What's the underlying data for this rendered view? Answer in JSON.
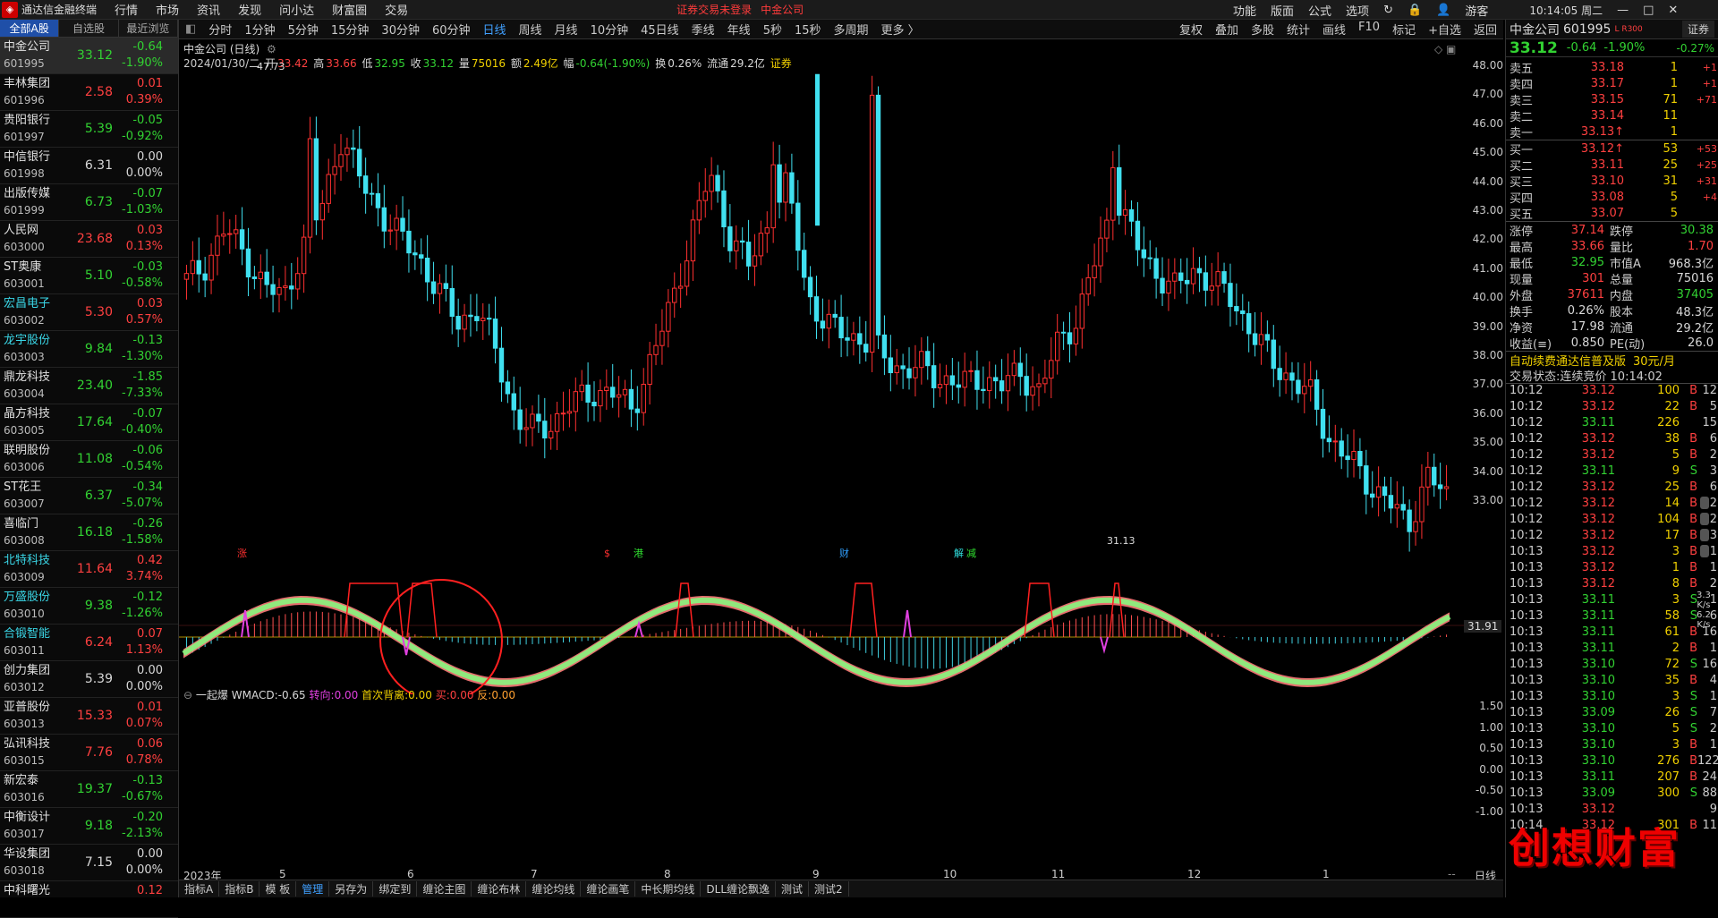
{
  "topbar": {
    "app_title": "通达信金融终端",
    "menus": [
      "行情",
      "市场",
      "资讯",
      "发现",
      "问小达",
      "财富圈",
      "交易"
    ],
    "warning": "证券交易未登录",
    "current_stock": "中金公司",
    "right_menus": [
      "功能",
      "版面",
      "公式",
      "选项"
    ],
    "guest": "游客",
    "time": "10:14:05 周二"
  },
  "stocklist": {
    "tabs": [
      "全部A股",
      "自选股",
      "最近浏览"
    ],
    "rows": [
      {
        "name": "中金公司",
        "code": "601995",
        "price": "33.12",
        "chg": "-0.64",
        "pct": "-1.90%",
        "color": "grn",
        "sel": true
      },
      {
        "name": "丰林集团",
        "code": "601996",
        "price": "2.58",
        "chg": "0.01",
        "pct": "0.39%",
        "color": "red"
      },
      {
        "name": "贵阳银行",
        "code": "601997",
        "price": "5.39",
        "chg": "-0.05",
        "pct": "-0.92%",
        "color": "grn"
      },
      {
        "name": "中信银行",
        "code": "601998",
        "price": "6.31",
        "chg": "0.00",
        "pct": "0.00%",
        "color": "wht"
      },
      {
        "name": "出版传媒",
        "code": "601999",
        "price": "6.73",
        "chg": "-0.07",
        "pct": "-1.03%",
        "color": "grn"
      },
      {
        "name": "人民网",
        "code": "603000",
        "price": "23.68",
        "chg": "0.03",
        "pct": "0.13%",
        "color": "red"
      },
      {
        "name": "ST奥康",
        "code": "603001",
        "price": "5.10",
        "chg": "-0.03",
        "pct": "-0.58%",
        "color": "grn"
      },
      {
        "name": "宏昌电子",
        "code": "603002",
        "price": "5.30",
        "chg": "0.03",
        "pct": "0.57%",
        "color": "red",
        "cy": true
      },
      {
        "name": "龙宇股份",
        "code": "603003",
        "price": "9.84",
        "chg": "-0.13",
        "pct": "-1.30%",
        "color": "grn",
        "cy": true
      },
      {
        "name": "鼎龙科技",
        "code": "603004",
        "price": "23.40",
        "chg": "-1.85",
        "pct": "-7.33%",
        "color": "grn"
      },
      {
        "name": "晶方科技",
        "code": "603005",
        "price": "17.64",
        "chg": "-0.07",
        "pct": "-0.40%",
        "color": "grn"
      },
      {
        "name": "联明股份",
        "code": "603006",
        "price": "11.08",
        "chg": "-0.06",
        "pct": "-0.54%",
        "color": "grn"
      },
      {
        "name": "ST花王",
        "code": "603007",
        "price": "6.37",
        "chg": "-0.34",
        "pct": "-5.07%",
        "color": "grn"
      },
      {
        "name": "喜临门",
        "code": "603008",
        "price": "16.18",
        "chg": "-0.26",
        "pct": "-1.58%",
        "color": "grn"
      },
      {
        "name": "北特科技",
        "code": "603009",
        "price": "11.64",
        "chg": "0.42",
        "pct": "3.74%",
        "color": "red",
        "cy": true
      },
      {
        "name": "万盛股份",
        "code": "603010",
        "price": "9.38",
        "chg": "-0.12",
        "pct": "-1.26%",
        "color": "grn",
        "cy": true
      },
      {
        "name": "合锻智能",
        "code": "603011",
        "price": "6.24",
        "chg": "0.07",
        "pct": "1.13%",
        "color": "red",
        "cy": true
      },
      {
        "name": "创力集团",
        "code": "603012",
        "price": "5.39",
        "chg": "0.00",
        "pct": "0.00%",
        "color": "wht"
      },
      {
        "name": "亚普股份",
        "code": "603013",
        "price": "15.33",
        "chg": "0.01",
        "pct": "0.07%",
        "color": "red"
      },
      {
        "name": "弘讯科技",
        "code": "603015",
        "price": "7.76",
        "chg": "0.06",
        "pct": "0.78%",
        "color": "red"
      },
      {
        "name": "新宏泰",
        "code": "603016",
        "price": "19.37",
        "chg": "-0.13",
        "pct": "-0.67%",
        "color": "grn"
      },
      {
        "name": "中衡设计",
        "code": "603017",
        "price": "9.18",
        "chg": "-0.20",
        "pct": "-2.13%",
        "color": "grn"
      },
      {
        "name": "华设集团",
        "code": "603018",
        "price": "7.15",
        "chg": "0.00",
        "pct": "0.00%",
        "color": "wht"
      },
      {
        "name": "中科曙光",
        "code": "",
        "price": "",
        "chg": "0.12",
        "pct": "",
        "color": "red"
      }
    ]
  },
  "periodbar": {
    "items": [
      "分时",
      "1分钟",
      "5分钟",
      "15分钟",
      "30分钟",
      "60分钟",
      "日线",
      "周线",
      "月线",
      "10分钟",
      "45日线",
      "季线",
      "年线",
      "5秒",
      "15秒",
      "多周期",
      "更多 〉"
    ],
    "active": "日线",
    "right": [
      "复权",
      "叠加",
      "多股",
      "统计",
      "画线",
      "F10",
      "标记",
      "+自选",
      "返回"
    ]
  },
  "chart": {
    "title": "中金公司 (日线)",
    "date": "2024/01/30/二",
    "open_label": "开",
    "open": "33.42",
    "high_label": "高",
    "high": "33.66",
    "low_label": "低",
    "low": "32.95",
    "close_label": "收",
    "close": "33.12",
    "vol_label": "量",
    "vol": "75016",
    "amt_label": "额",
    "amt": "2.49亿",
    "range_label": "幅",
    "range": "-0.64(-1.90%)",
    "turn_label": "换",
    "turn": "0.26%",
    "float_label": "流通",
    "float": "29.2亿",
    "tag": "证券",
    "max_label": "47.73",
    "min_label": "31.13",
    "cur_price": "31.91",
    "price_ticks": [
      "48.00",
      "47.00",
      "46.00",
      "45.00",
      "44.00",
      "43.00",
      "42.00",
      "41.00",
      "40.00",
      "39.00",
      "38.00",
      "37.00",
      "36.00",
      "35.00",
      "34.00",
      "33.00"
    ],
    "event_marks": [
      "涨",
      "$",
      "港",
      "财",
      "解",
      "减"
    ],
    "indicator": {
      "name": "一起爆",
      "wmacd_label": "WMACD:",
      "wmacd": "-0.65",
      "zx_label": "转向:",
      "zx": "0.00",
      "sc_label": "首次背离:",
      "sc": "0.00",
      "buy_label": "买:",
      "buy": "0.00",
      "fan_label": "反:",
      "fan": "0.00",
      "ticks": [
        "1.50",
        "1.00",
        "0.50",
        "0.00",
        "-0.50",
        "-1.00"
      ]
    },
    "x_labels": [
      "2023年",
      "5",
      "6",
      "7",
      "8",
      "9",
      "10",
      "11",
      "12",
      "1"
    ],
    "x_right": "日线"
  },
  "chart_data": {
    "type": "candlestick",
    "title": "中金公司 (日线)",
    "ylim": [
      31.0,
      48.5
    ],
    "x": [
      "2023年",
      "5",
      "6",
      "7",
      "8",
      "9",
      "10",
      "11",
      "12",
      "1"
    ],
    "close": [
      40.6,
      41.2,
      42.4,
      41.5,
      40.4,
      40.0,
      41.8,
      43.2,
      45.6,
      44.0,
      43.0,
      42.1,
      41.4,
      40.2,
      39.2,
      39.6,
      38.1,
      35.8,
      35.4,
      35.8,
      36.4,
      36.8,
      36.7,
      36.2,
      37.9,
      39.8,
      42.1,
      44.3,
      42.2,
      41.1,
      42.6,
      43.9,
      40.2,
      39.0,
      38.8,
      38.5,
      38.0,
      37.5,
      37.6,
      37.2,
      37.0,
      37.3,
      36.9,
      37.5,
      36.7,
      38.6,
      39.3,
      41.6,
      43.5,
      41.8,
      40.9,
      40.3,
      41.0,
      40.5,
      39.9,
      38.8,
      37.8,
      37.2,
      36.6,
      35.1,
      34.4,
      33.6,
      33.0,
      32.1,
      33.9,
      33.12
    ]
  },
  "quote": {
    "name": "中金公司",
    "code": "601995",
    "badge": "L R300",
    "tab": "证券",
    "price": "33.12",
    "chg": "-0.64",
    "pct": "-1.90%",
    "pct2": "-0.27%",
    "asks": [
      {
        "l": "卖五",
        "p": "33.18",
        "v": "1",
        "d": "+1"
      },
      {
        "l": "卖四",
        "p": "33.17",
        "v": "1",
        "d": "+1"
      },
      {
        "l": "卖三",
        "p": "33.15",
        "v": "71",
        "d": "+71"
      },
      {
        "l": "卖二",
        "p": "33.14",
        "v": "11",
        "d": ""
      },
      {
        "l": "卖一",
        "p": "33.13↑",
        "v": "1",
        "d": ""
      }
    ],
    "bids": [
      {
        "l": "买一",
        "p": "33.12↑",
        "v": "53",
        "d": "+53"
      },
      {
        "l": "买二",
        "p": "33.11",
        "v": "25",
        "d": "+25"
      },
      {
        "l": "买三",
        "p": "33.10",
        "v": "31",
        "d": "+31"
      },
      {
        "l": "买四",
        "p": "33.08",
        "v": "5",
        "d": "+4"
      },
      {
        "l": "买五",
        "p": "33.07",
        "v": "5",
        "d": ""
      }
    ],
    "stats": [
      {
        "a": "涨停",
        "b": "37.14",
        "bc": "red",
        "c": "跌停",
        "d": "30.38",
        "dc": "grn"
      },
      {
        "a": "最高",
        "b": "33.66",
        "bc": "red",
        "c": "量比",
        "d": "1.70",
        "dc": "red"
      },
      {
        "a": "最低",
        "b": "32.95",
        "bc": "grn",
        "c": "市值A",
        "d": "968.3亿",
        "dc": "wht"
      },
      {
        "a": "现量",
        "b": "301",
        "bc": "red",
        "c": "总量",
        "d": "75016",
        "dc": "wht"
      },
      {
        "a": "外盘",
        "b": "37611",
        "bc": "red",
        "c": "内盘",
        "d": "37405",
        "dc": "grn"
      },
      {
        "a": "换手",
        "b": "0.26%",
        "bc": "wht",
        "c": "股本",
        "d": "48.3亿",
        "dc": "wht"
      },
      {
        "a": "净资",
        "b": "17.98",
        "bc": "wht",
        "c": "流通",
        "d": "29.2亿",
        "dc": "wht"
      },
      {
        "a": "收益(≡)",
        "b": "0.850",
        "bc": "wht",
        "c": "PE(动)",
        "d": "26.0",
        "dc": "wht"
      }
    ],
    "ad": "自动续费通达信普及版",
    "ad_price": "30元/月",
    "status_label": "交易状态:",
    "status": "连续竞价 10:14:02",
    "ticks": [
      {
        "t": "10:12",
        "p": "33.12",
        "v": "100",
        "d": "B",
        "n": "12"
      },
      {
        "t": "10:12",
        "p": "33.12",
        "v": "22",
        "d": "B",
        "n": "5"
      },
      {
        "t": "10:12",
        "p": "33.11",
        "v": "226",
        "d": "",
        "n": "15"
      },
      {
        "t": "10:12",
        "p": "33.12",
        "v": "38",
        "d": "B",
        "n": "6"
      },
      {
        "t": "10:12",
        "p": "33.12",
        "v": "5",
        "d": "B",
        "n": "2"
      },
      {
        "t": "10:12",
        "p": "33.11",
        "v": "9",
        "d": "S",
        "n": "3"
      },
      {
        "t": "10:12",
        "p": "33.12",
        "v": "25",
        "d": "B",
        "n": "6"
      },
      {
        "t": "10:12",
        "p": "33.12",
        "v": "14",
        "d": "B",
        "n": "2"
      },
      {
        "t": "10:12",
        "p": "33.12",
        "v": "104",
        "d": "B",
        "n": "2"
      },
      {
        "t": "10:12",
        "p": "33.12",
        "v": "17",
        "d": "B",
        "n": "3"
      },
      {
        "t": "10:13",
        "p": "33.12",
        "v": "3",
        "d": "B",
        "n": "1"
      },
      {
        "t": "10:13",
        "p": "33.12",
        "v": "1",
        "d": "B",
        "n": "1"
      },
      {
        "t": "10:13",
        "p": "33.12",
        "v": "8",
        "d": "B",
        "n": "2"
      },
      {
        "t": "10:13",
        "p": "33.11",
        "v": "3",
        "d": "S",
        "n": "1"
      },
      {
        "t": "10:13",
        "p": "33.11",
        "v": "58",
        "d": "S",
        "n": "6"
      },
      {
        "t": "10:13",
        "p": "33.11",
        "v": "61",
        "d": "B",
        "n": "16"
      },
      {
        "t": "10:13",
        "p": "33.11",
        "v": "2",
        "d": "B",
        "n": "1"
      },
      {
        "t": "10:13",
        "p": "33.10",
        "v": "72",
        "d": "S",
        "n": "16"
      },
      {
        "t": "10:13",
        "p": "33.10",
        "v": "35",
        "d": "B",
        "n": "4"
      },
      {
        "t": "10:13",
        "p": "33.10",
        "v": "3",
        "d": "S",
        "n": "1"
      },
      {
        "t": "10:13",
        "p": "33.09",
        "v": "26",
        "d": "S",
        "n": "7"
      },
      {
        "t": "10:13",
        "p": "33.10",
        "v": "5",
        "d": "S",
        "n": "2"
      },
      {
        "t": "10:13",
        "p": "33.10",
        "v": "3",
        "d": "B",
        "n": "1"
      },
      {
        "t": "10:13",
        "p": "33.10",
        "v": "276",
        "d": "B",
        "n": "122"
      },
      {
        "t": "10:13",
        "p": "33.11",
        "v": "207",
        "d": "B",
        "n": "24"
      },
      {
        "t": "10:13",
        "p": "33.09",
        "v": "300",
        "d": "S",
        "n": "88"
      },
      {
        "t": "10:13",
        "p": "33.12",
        "v": "",
        "d": "",
        "n": "9"
      },
      {
        "t": "10:14",
        "p": "33.12",
        "v": "301",
        "d": "B",
        "n": "11"
      }
    ],
    "speed": [
      "3.3",
      "K/s",
      "6.2",
      "K/s"
    ]
  },
  "bottomtabs": {
    "items": [
      "指标A",
      "指标B",
      "模 板",
      "管理",
      "另存为",
      "绑定到",
      "缠论主图",
      "缠论布林",
      "缠论均线",
      "缠论画笔",
      "中长期均线",
      "DLL缠论飘逸",
      "测试",
      "测试2"
    ],
    "active": "管理"
  },
  "watermark": "创想财富",
  "colors": {
    "up": "#ff4040",
    "down": "#32d2e6",
    "accent": "#1f4fa8",
    "yellow": "#f0d000"
  }
}
